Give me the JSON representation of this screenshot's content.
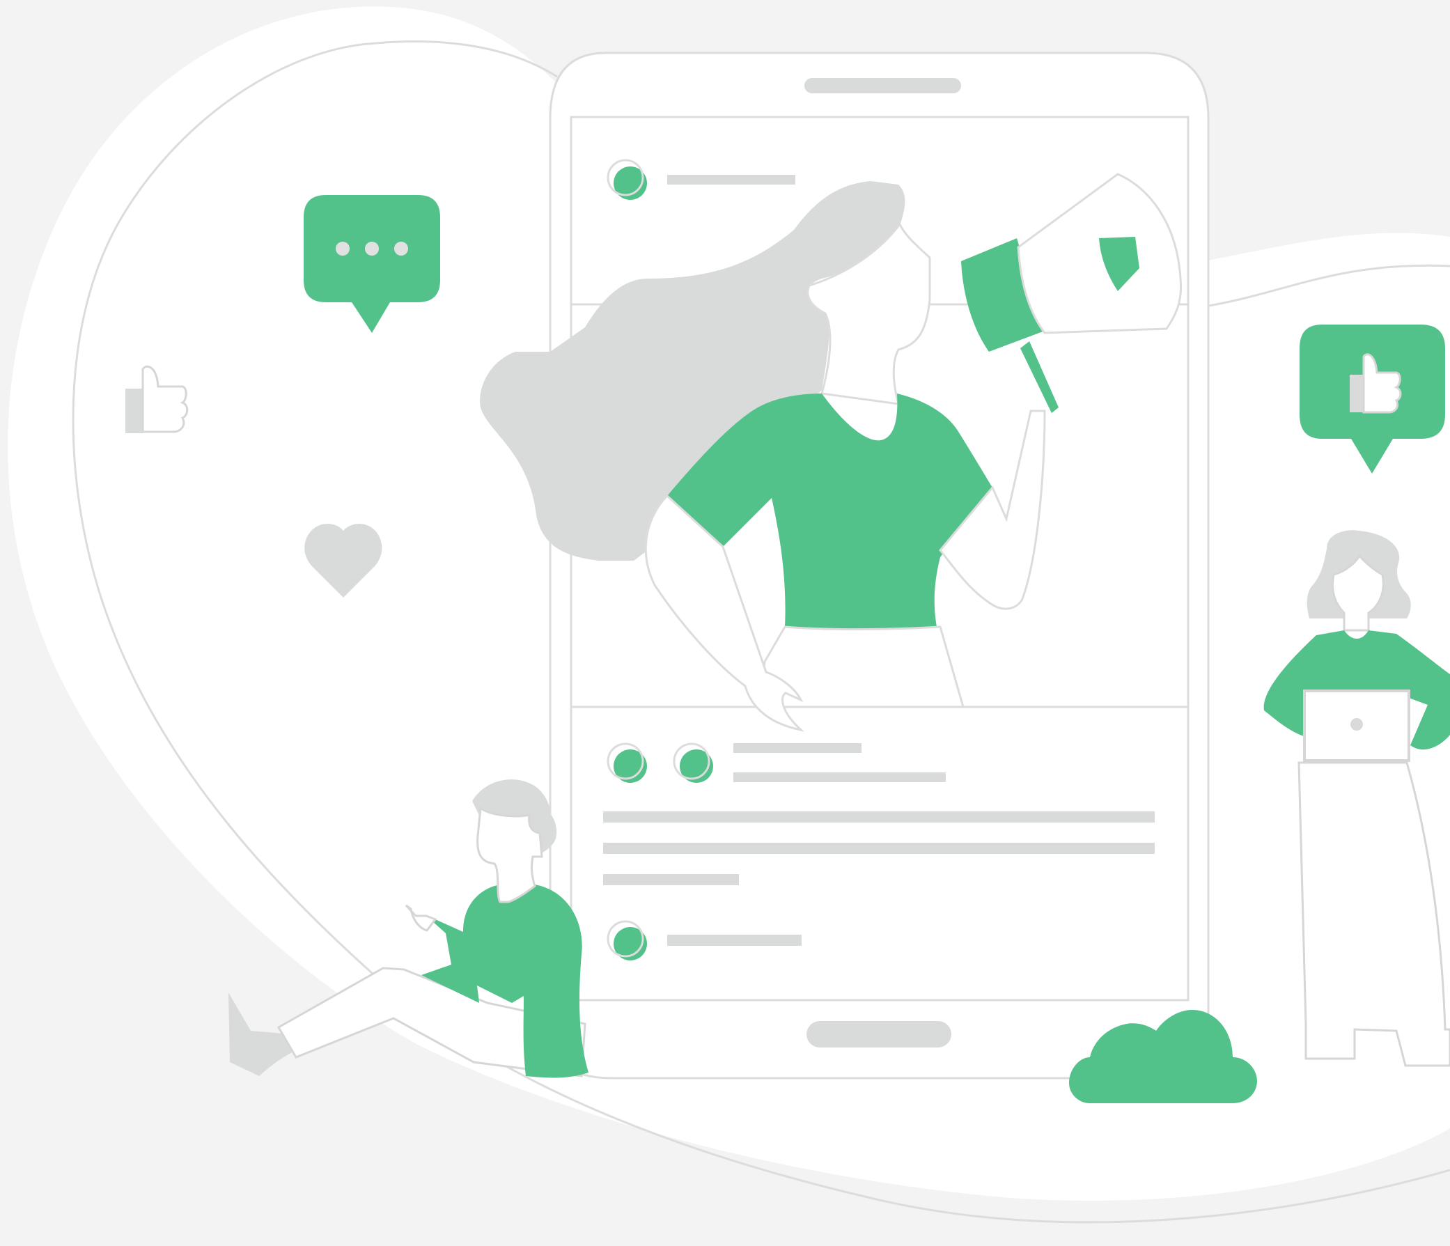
{
  "illustration": {
    "theme": "social-media-marketing",
    "colors": {
      "background": "#f3f3f3",
      "accent_green": "#53c28a",
      "light_gray": "#d9dbda",
      "outline_gray": "#d6d6d6",
      "white": "#ffffff"
    },
    "icons": [
      "chat-bubble-icon",
      "thumbs-up-icon",
      "heart-icon",
      "like-bubble-icon",
      "megaphone-icon",
      "cloud-icon",
      "laptop-icon",
      "smartphone-icon"
    ],
    "figures": [
      "woman-with-megaphone",
      "man-sitting-with-phone",
      "woman-with-laptop"
    ]
  }
}
